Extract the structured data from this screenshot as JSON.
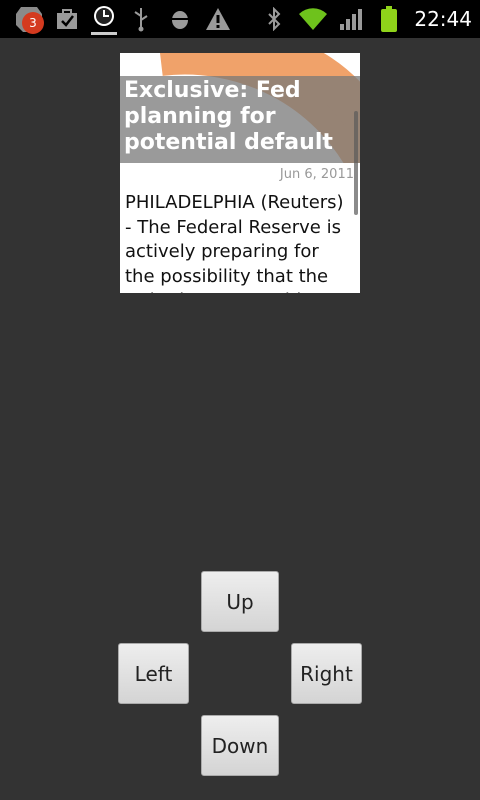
{
  "status_bar": {
    "notification_count": "3",
    "time": "22:44",
    "icons": [
      "notification-stack-icon",
      "shopping-bag-icon",
      "alarm-clock-icon",
      "usb-icon",
      "android-debug-icon",
      "warning-icon",
      "bluetooth-icon",
      "wifi-icon",
      "signal-icon",
      "battery-icon"
    ]
  },
  "widget": {
    "title": "Exclusive: Fed planning for potential default",
    "date": "Jun 6, 2011",
    "body": "PHILADELPHIA (Reuters) - The Federal Reserve is actively preparing for the possibility that the United States could"
  },
  "controls": {
    "up": "Up",
    "left": "Left",
    "right": "Right",
    "down": "Down"
  }
}
